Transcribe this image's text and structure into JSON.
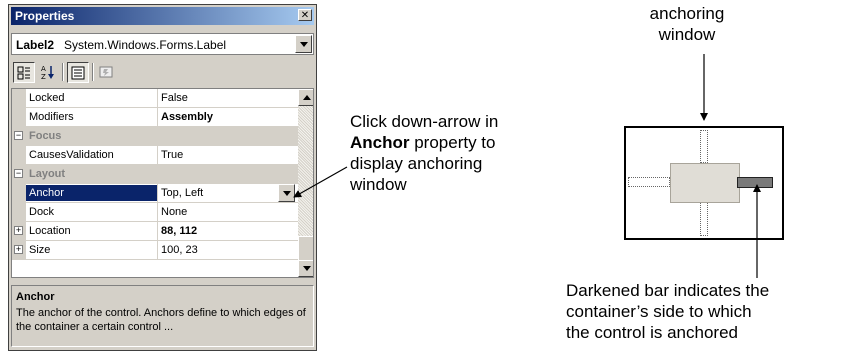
{
  "window": {
    "title": "Properties",
    "close_glyph": "✕"
  },
  "object_selector": {
    "name": "Label2",
    "type": "System.Windows.Forms.Label"
  },
  "toolbar": {
    "categorized_icon": "categorized-icon",
    "alphabetical_icon": "alphabetical-icon",
    "properties_icon": "properties-icon",
    "events_icon": "events-icon"
  },
  "grid": {
    "rows": [
      {
        "kind": "prop",
        "name": "Locked",
        "value": "False"
      },
      {
        "kind": "prop",
        "name": "Modifiers",
        "value": "Assembly",
        "bold": true
      },
      {
        "kind": "cat",
        "name": "Focus",
        "expander": "⊟"
      },
      {
        "kind": "prop",
        "name": "CausesValidation",
        "value": "True"
      },
      {
        "kind": "cat",
        "name": "Layout",
        "expander": "⊟"
      },
      {
        "kind": "prop",
        "name": "Anchor",
        "value": "Top, Left",
        "selected": true
      },
      {
        "kind": "prop",
        "name": "Dock",
        "value": "None"
      },
      {
        "kind": "prop",
        "name": "Location",
        "value": "88, 112",
        "bold": true,
        "expander": "+"
      },
      {
        "kind": "prop",
        "name": "Size",
        "value": "100, 23",
        "expander": "+"
      }
    ]
  },
  "description": {
    "title": "Anchor",
    "text": "The anchor of the control. Anchors define to which edges of the container a certain control ..."
  },
  "callouts": {
    "dropdown": {
      "line1": "Click down-arrow in",
      "bold_word": "Anchor",
      "line2_rest": " property to",
      "line3": "display anchoring",
      "line4": "window"
    },
    "window_label": {
      "line1": "anchoring",
      "line2": "window"
    },
    "bar_note": {
      "line1": "Darkened bar indicates the",
      "line2": "container’s side to which",
      "line3": "the control is anchored"
    }
  },
  "colors": {
    "title_bar": "#0a246a",
    "selection": "#0a246a",
    "chrome": "#d4d0c8",
    "darkened_bar": "#7a7a7a"
  }
}
